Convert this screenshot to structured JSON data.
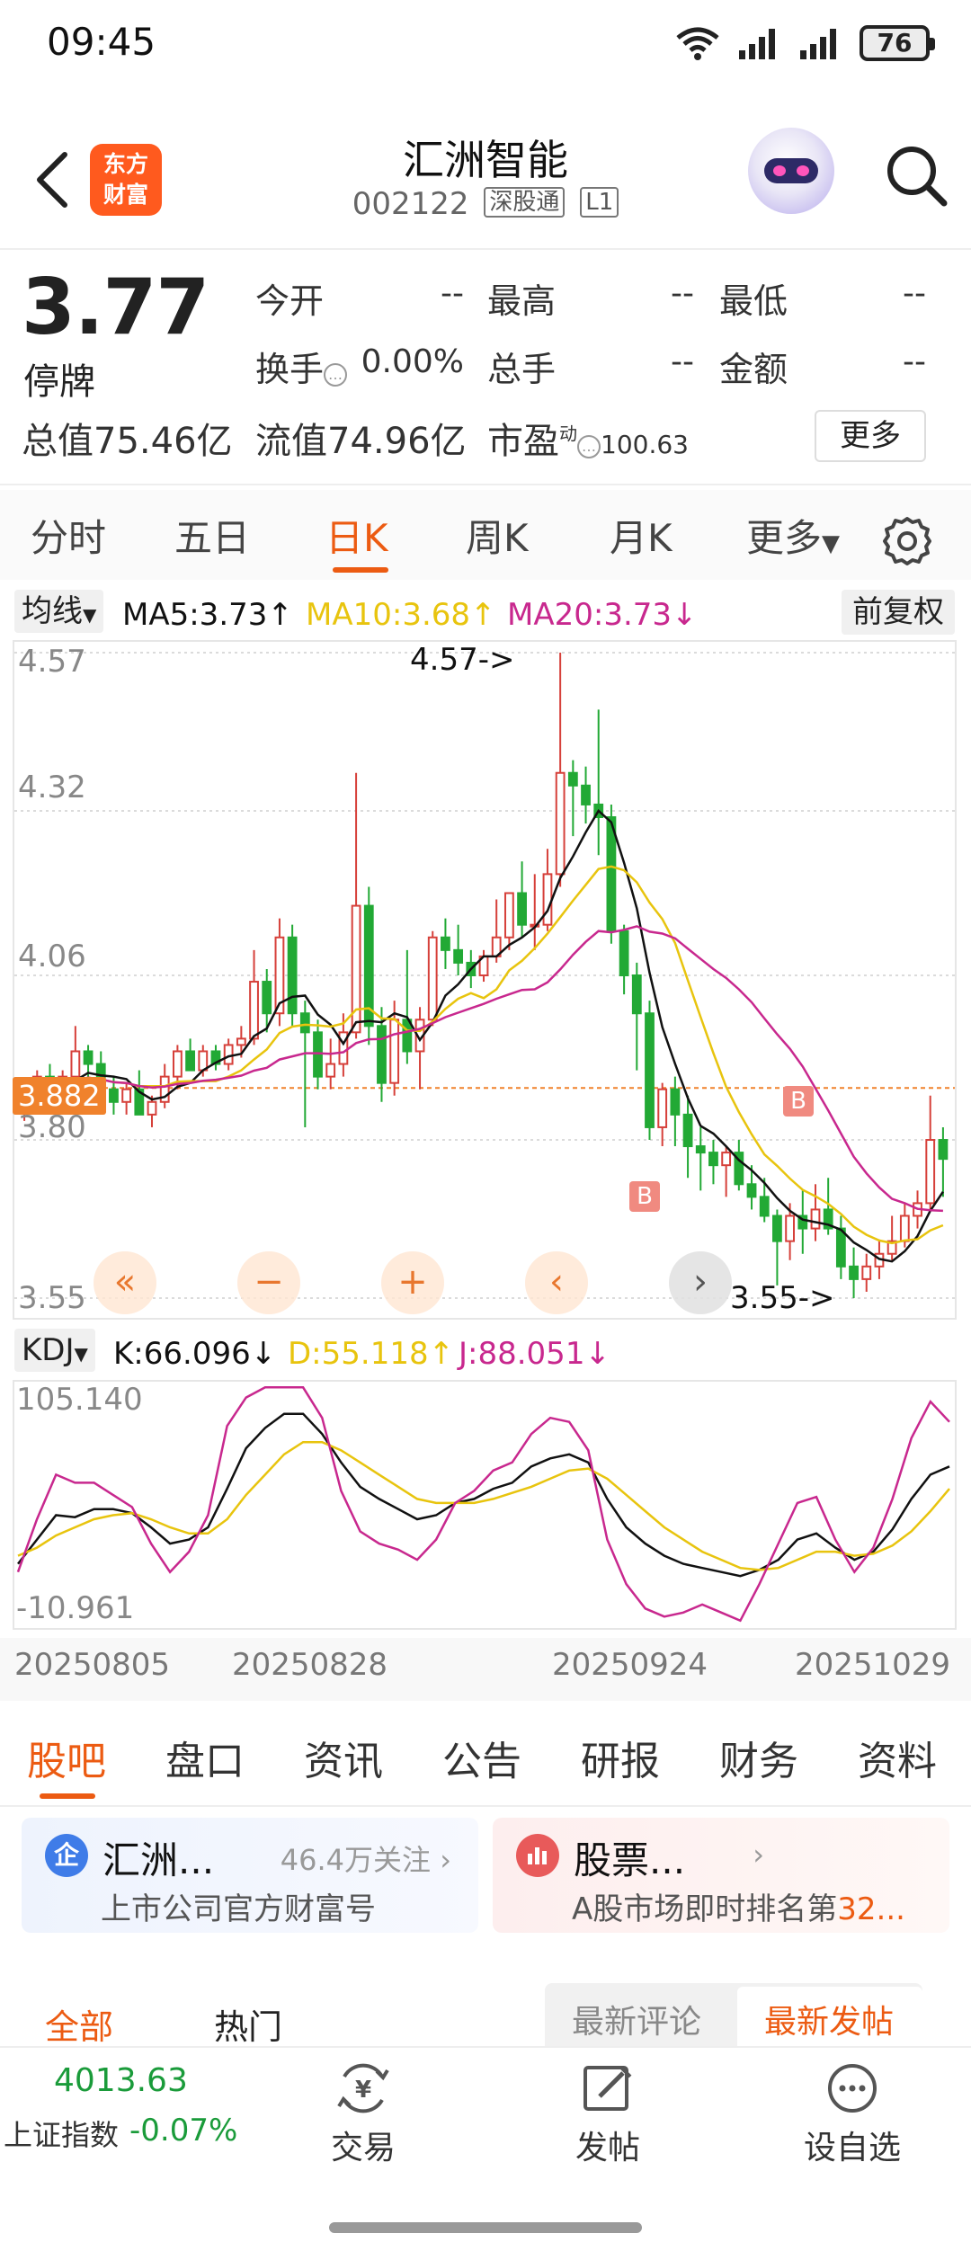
{
  "status_bar": {
    "time": "09:45",
    "battery": "76"
  },
  "header": {
    "logo_line1": "东方",
    "logo_line2": "财富",
    "title": "汇洲智能",
    "code": "002122",
    "tag1": "深股通",
    "tag2": "L1"
  },
  "quote": {
    "price": "3.77",
    "status": "停牌",
    "open_label": "今开",
    "open_value": "--",
    "high_label": "最高",
    "high_value": "--",
    "low_label": "最低",
    "low_value": "--",
    "turnover_label": "换手",
    "turnover_value": "0.00%",
    "volume_label": "总手",
    "volume_value": "--",
    "amount_label": "金额",
    "amount_value": "--",
    "mktcap_label": "总值",
    "mktcap_value": "75.46亿",
    "float_label": "流值",
    "float_value": "74.96亿",
    "pe_label": "市盈",
    "pe_sup": "动",
    "pe_value": "100.63",
    "more_button": "更多"
  },
  "period_tabs": [
    "分时",
    "五日",
    "日K",
    "周K",
    "月K",
    "更多"
  ],
  "active_period": "日K",
  "indicators": {
    "ma_selector": "均线",
    "ma5": "MA5:3.73↑",
    "ma10": "MA10:3.68↑",
    "ma20": "MA20:3.73↓",
    "adjust_button": "前复权",
    "kdj_selector": "KDJ",
    "k": "K:66.096↓",
    "d": "D:55.118↑",
    "j": "J:88.051↓"
  },
  "colors": {
    "up": "#d6403a",
    "down": "#22a935",
    "ma5": "#111111",
    "ma10": "#e8c40e",
    "ma20": "#c8288e",
    "accent": "#ec5b12",
    "crosshair": "#f0822c"
  },
  "chart_data": [
    {
      "type": "candlestick",
      "title": "日K",
      "y_ticks": [
        "4.57",
        "4.32",
        "4.06",
        "3.80",
        "3.55"
      ],
      "ylim": [
        3.55,
        4.57
      ],
      "x_tick_labels": [
        "20250805",
        "20250828",
        "20250924",
        "20251029"
      ],
      "price_line": "3.882",
      "annotations": [
        "4.57->",
        "3.55->",
        "B",
        "B"
      ],
      "candles": [
        {
          "o": 3.85,
          "h": 3.87,
          "l": 3.83,
          "c": 3.86
        },
        {
          "o": 3.86,
          "h": 3.91,
          "l": 3.85,
          "c": 3.9
        },
        {
          "o": 3.9,
          "h": 3.92,
          "l": 3.86,
          "c": 3.87
        },
        {
          "o": 3.87,
          "h": 3.91,
          "l": 3.86,
          "c": 3.9
        },
        {
          "o": 3.9,
          "h": 3.98,
          "l": 3.89,
          "c": 3.94
        },
        {
          "o": 3.94,
          "h": 3.95,
          "l": 3.9,
          "c": 3.92
        },
        {
          "o": 3.92,
          "h": 3.94,
          "l": 3.87,
          "c": 3.88
        },
        {
          "o": 3.88,
          "h": 3.9,
          "l": 3.84,
          "c": 3.86
        },
        {
          "o": 3.86,
          "h": 3.89,
          "l": 3.84,
          "c": 3.88
        },
        {
          "o": 3.88,
          "h": 3.91,
          "l": 3.84,
          "c": 3.84
        },
        {
          "o": 3.84,
          "h": 3.87,
          "l": 3.82,
          "c": 3.86
        },
        {
          "o": 3.86,
          "h": 3.92,
          "l": 3.85,
          "c": 3.9
        },
        {
          "o": 3.9,
          "h": 3.95,
          "l": 3.88,
          "c": 3.94
        },
        {
          "o": 3.94,
          "h": 3.96,
          "l": 3.91,
          "c": 3.91
        },
        {
          "o": 3.91,
          "h": 3.95,
          "l": 3.9,
          "c": 3.94
        },
        {
          "o": 3.94,
          "h": 3.95,
          "l": 3.91,
          "c": 3.92
        },
        {
          "o": 3.92,
          "h": 3.96,
          "l": 3.91,
          "c": 3.95
        },
        {
          "o": 3.95,
          "h": 3.98,
          "l": 3.93,
          "c": 3.96
        },
        {
          "o": 3.96,
          "h": 4.1,
          "l": 3.95,
          "c": 4.05
        },
        {
          "o": 4.05,
          "h": 4.07,
          "l": 3.97,
          "c": 4.0
        },
        {
          "o": 4.0,
          "h": 4.15,
          "l": 3.98,
          "c": 4.12
        },
        {
          "o": 4.12,
          "h": 4.14,
          "l": 3.98,
          "c": 4.0
        },
        {
          "o": 4.0,
          "h": 4.02,
          "l": 3.82,
          "c": 3.97
        },
        {
          "o": 3.97,
          "h": 3.99,
          "l": 3.88,
          "c": 3.9
        },
        {
          "o": 3.9,
          "h": 3.96,
          "l": 3.88,
          "c": 3.92
        },
        {
          "o": 3.92,
          "h": 4.0,
          "l": 3.9,
          "c": 3.97
        },
        {
          "o": 3.97,
          "h": 4.38,
          "l": 3.96,
          "c": 4.17
        },
        {
          "o": 4.17,
          "h": 4.2,
          "l": 3.95,
          "c": 3.98
        },
        {
          "o": 3.98,
          "h": 4.01,
          "l": 3.86,
          "c": 3.89
        },
        {
          "o": 3.89,
          "h": 4.02,
          "l": 3.87,
          "c": 3.99
        },
        {
          "o": 3.99,
          "h": 4.1,
          "l": 3.92,
          "c": 3.94
        },
        {
          "o": 3.94,
          "h": 4.01,
          "l": 3.88,
          "c": 3.99
        },
        {
          "o": 3.99,
          "h": 4.13,
          "l": 3.98,
          "c": 4.12
        },
        {
          "o": 4.12,
          "h": 4.15,
          "l": 4.07,
          "c": 4.1
        },
        {
          "o": 4.1,
          "h": 4.14,
          "l": 4.06,
          "c": 4.08
        },
        {
          "o": 4.08,
          "h": 4.1,
          "l": 4.04,
          "c": 4.06
        },
        {
          "o": 4.06,
          "h": 4.1,
          "l": 4.05,
          "c": 4.09
        },
        {
          "o": 4.09,
          "h": 4.18,
          "l": 4.08,
          "c": 4.12
        },
        {
          "o": 4.12,
          "h": 4.19,
          "l": 4.1,
          "c": 4.19
        },
        {
          "o": 4.19,
          "h": 4.24,
          "l": 4.12,
          "c": 4.14
        },
        {
          "o": 4.14,
          "h": 4.22,
          "l": 4.1,
          "c": 4.14
        },
        {
          "o": 4.14,
          "h": 4.26,
          "l": 4.13,
          "c": 4.22
        },
        {
          "o": 4.22,
          "h": 4.57,
          "l": 4.2,
          "c": 4.38
        },
        {
          "o": 4.38,
          "h": 4.4,
          "l": 4.28,
          "c": 4.36
        },
        {
          "o": 4.36,
          "h": 4.39,
          "l": 4.3,
          "c": 4.33
        },
        {
          "o": 4.33,
          "h": 4.48,
          "l": 4.25,
          "c": 4.31
        },
        {
          "o": 4.31,
          "h": 4.33,
          "l": 4.11,
          "c": 4.13
        },
        {
          "o": 4.13,
          "h": 4.14,
          "l": 4.03,
          "c": 4.06
        },
        {
          "o": 4.06,
          "h": 4.08,
          "l": 3.91,
          "c": 4.0
        },
        {
          "o": 4.0,
          "h": 4.02,
          "l": 3.8,
          "c": 3.82
        },
        {
          "o": 3.82,
          "h": 3.89,
          "l": 3.79,
          "c": 3.88
        },
        {
          "o": 3.88,
          "h": 3.9,
          "l": 3.79,
          "c": 3.84
        },
        {
          "o": 3.84,
          "h": 3.87,
          "l": 3.74,
          "c": 3.79
        },
        {
          "o": 3.79,
          "h": 3.82,
          "l": 3.72,
          "c": 3.78
        },
        {
          "o": 3.78,
          "h": 3.8,
          "l": 3.73,
          "c": 3.76
        },
        {
          "o": 3.76,
          "h": 3.79,
          "l": 3.71,
          "c": 3.78
        },
        {
          "o": 3.78,
          "h": 3.8,
          "l": 3.72,
          "c": 3.73
        },
        {
          "o": 3.73,
          "h": 3.76,
          "l": 3.69,
          "c": 3.71
        },
        {
          "o": 3.71,
          "h": 3.74,
          "l": 3.67,
          "c": 3.68
        },
        {
          "o": 3.68,
          "h": 3.69,
          "l": 3.57,
          "c": 3.64
        },
        {
          "o": 3.64,
          "h": 3.7,
          "l": 3.61,
          "c": 3.68
        },
        {
          "o": 3.68,
          "h": 3.72,
          "l": 3.62,
          "c": 3.66
        },
        {
          "o": 3.66,
          "h": 3.73,
          "l": 3.64,
          "c": 3.69
        },
        {
          "o": 3.69,
          "h": 3.74,
          "l": 3.65,
          "c": 3.66
        },
        {
          "o": 3.66,
          "h": 3.68,
          "l": 3.58,
          "c": 3.6
        },
        {
          "o": 3.6,
          "h": 3.63,
          "l": 3.55,
          "c": 3.58
        },
        {
          "o": 3.58,
          "h": 3.62,
          "l": 3.56,
          "c": 3.6
        },
        {
          "o": 3.6,
          "h": 3.64,
          "l": 3.58,
          "c": 3.62
        },
        {
          "o": 3.62,
          "h": 3.68,
          "l": 3.61,
          "c": 3.64
        },
        {
          "o": 3.64,
          "h": 3.7,
          "l": 3.63,
          "c": 3.68
        },
        {
          "o": 3.68,
          "h": 3.72,
          "l": 3.66,
          "c": 3.7
        },
        {
          "o": 3.7,
          "h": 3.87,
          "l": 3.69,
          "c": 3.8
        },
        {
          "o": 3.8,
          "h": 3.82,
          "l": 3.71,
          "c": 3.77
        }
      ]
    },
    {
      "type": "line",
      "title": "KDJ",
      "ylim": [
        -10.961,
        105.14
      ],
      "y_ticks": [
        "105.140",
        "-10.961"
      ],
      "series": [
        {
          "name": "K",
          "values": [
            18,
            30,
            42,
            41,
            45,
            45,
            43,
            36,
            28,
            30,
            36,
            55,
            75,
            85,
            92,
            92,
            82,
            68,
            56,
            50,
            45,
            40,
            42,
            48,
            50,
            55,
            58,
            66,
            70,
            72,
            68,
            50,
            36,
            28,
            22,
            18,
            16,
            14,
            12,
            15,
            20,
            30,
            33,
            26,
            20,
            24,
            35,
            50,
            62,
            66
          ]
        },
        {
          "name": "D",
          "values": [
            22,
            26,
            32,
            36,
            40,
            42,
            43,
            40,
            36,
            33,
            33,
            40,
            52,
            62,
            72,
            78,
            78,
            74,
            68,
            62,
            56,
            50,
            48,
            48,
            48,
            50,
            53,
            56,
            60,
            64,
            65,
            60,
            52,
            44,
            36,
            30,
            24,
            20,
            16,
            15,
            16,
            20,
            24,
            24,
            22,
            23,
            27,
            34,
            44,
            55
          ]
        },
        {
          "name": "J",
          "values": [
            14,
            40,
            62,
            58,
            58,
            52,
            46,
            28,
            14,
            24,
            42,
            86,
            100,
            105,
            105,
            105,
            90,
            54,
            34,
            28,
            25,
            20,
            30,
            48,
            54,
            64,
            68,
            82,
            90,
            88,
            74,
            30,
            8,
            -4,
            -8,
            -6,
            -2,
            -6,
            -10,
            8,
            28,
            48,
            51,
            30,
            14,
            26,
            50,
            80,
            98,
            88
          ]
        }
      ]
    }
  ],
  "bottom_tabs": [
    "股吧",
    "盘口",
    "资讯",
    "公告",
    "研报",
    "财务",
    "资料"
  ],
  "active_bottom_tab": "股吧",
  "cards": [
    {
      "icon": "企",
      "title": "汇洲...",
      "meta": "46.4万关注",
      "subtitle": "上市公司官方财富号"
    },
    {
      "icon": "▮",
      "title": "股票...",
      "meta": "",
      "subtitle_prefix": "A股市场即时排名第",
      "subtitle_highlight": "32..."
    }
  ],
  "filters": {
    "all": "全部",
    "hot": "热门",
    "latest_comment": "最新评论",
    "latest_post": "最新发帖"
  },
  "bottom_bar": {
    "index_value": "4013.63",
    "index_name": "上证指数",
    "index_change": "-0.07%",
    "trade": "交易",
    "post": "发帖",
    "watchlist": "设自选"
  }
}
